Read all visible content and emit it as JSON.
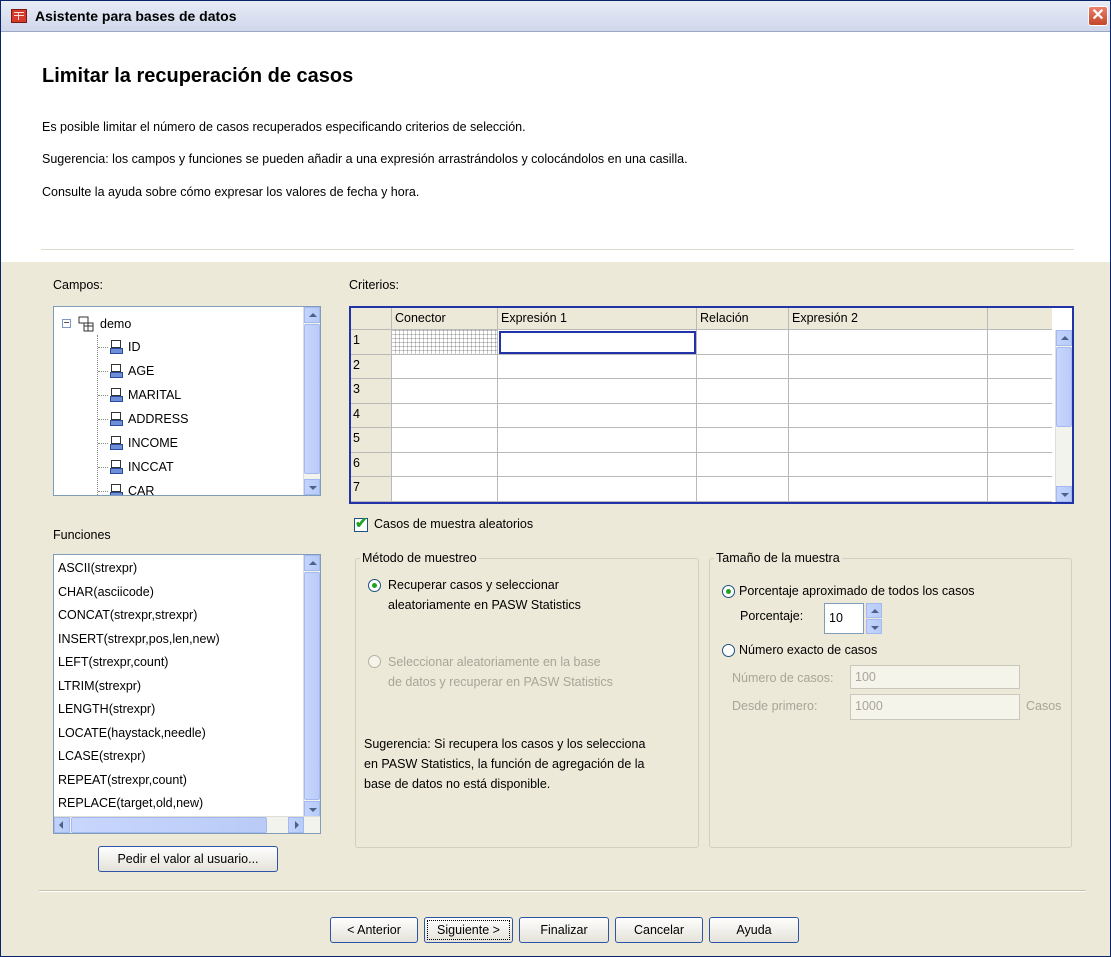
{
  "window": {
    "title": "Asistente para bases de datos",
    "close_glyph": "✕"
  },
  "header": {
    "title": "Limitar la recuperación de casos",
    "lines": [
      "Es posible limitar el número de casos recuperados especificando criterios de selección.",
      "Sugerencia: los campos y funciones se pueden añadir a una expresión arrastrándolos y colocándolos en una casilla.",
      "Consulte la ayuda sobre cómo expresar los valores de fecha y hora."
    ]
  },
  "fields": {
    "label": "Campos:",
    "root": "demo",
    "items": [
      "ID",
      "AGE",
      "MARITAL",
      "ADDRESS",
      "INCOME",
      "INCCAT",
      "CAR"
    ]
  },
  "functions": {
    "label": "Funciones",
    "items": [
      "ASCII(strexpr)",
      "CHAR(asciicode)",
      "CONCAT(strexpr,strexpr)",
      "INSERT(strexpr,pos,len,new)",
      "LEFT(strexpr,count)",
      "LTRIM(strexpr)",
      "LENGTH(strexpr)",
      "LOCATE(haystack,needle)",
      "LCASE(strexpr)",
      "REPEAT(strexpr,count)",
      "REPLACE(target,old,new)"
    ]
  },
  "prompt_button": "Pedir el valor al usuario...",
  "criteria": {
    "label": "Criterios:",
    "columns": [
      "Conector",
      "Expresión 1",
      "Relación",
      "Expresión 2"
    ],
    "rows": [
      "1",
      "2",
      "3",
      "4",
      "5",
      "6",
      "7"
    ]
  },
  "random_sample": {
    "label": "Casos de muestra aleatorios",
    "checked": true
  },
  "sampling_method": {
    "title": "Método de muestreo",
    "option1": [
      "Recuperar casos y seleccionar",
      "aleatoriamente en PASW Statistics"
    ],
    "option2": [
      "Seleccionar aleatoriamente en la base",
      "de datos y recuperar en PASW Statistics"
    ],
    "hint": [
      "Sugerencia: Si recupera los casos y los selecciona",
      "en PASW Statistics, la función de agregación de la",
      "base de datos no está disponible."
    ]
  },
  "sample_size": {
    "title": "Tamaño de la muestra",
    "approx_label": "Porcentaje aproximado de todos los casos",
    "percent_label": "Porcentaje:",
    "percent_value": "10",
    "exact_label": "Número exacto de casos",
    "num_cases_label": "Número de casos:",
    "num_cases_value": "100",
    "from_first_label": "Desde primero:",
    "from_first_value": "1000",
    "cases_unit": "Casos"
  },
  "buttons": {
    "back": "< Anterior",
    "next": "Siguiente >",
    "finish": "Finalizar",
    "cancel": "Cancelar",
    "help": "Ayuda"
  }
}
